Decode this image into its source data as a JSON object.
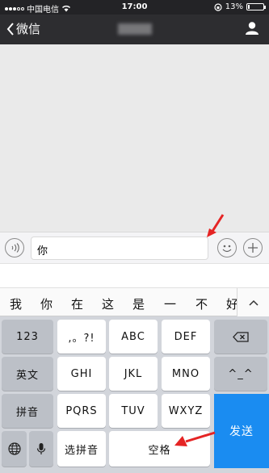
{
  "status_bar": {
    "carrier": "中国电信",
    "time": "17:00",
    "battery_percent": "13%",
    "battery_level": 0.13
  },
  "nav_bar": {
    "back_label": "微信"
  },
  "input_bar": {
    "text": "你"
  },
  "candidates": [
    "我",
    "你",
    "在",
    "这",
    "是",
    "一",
    "不",
    "好"
  ],
  "keyboard": {
    "row1": [
      "123",
      ",。?!",
      "ABC",
      "DEF"
    ],
    "row2": [
      "英文",
      "GHI",
      "JKL",
      "MNO",
      "^_^"
    ],
    "row3": [
      "拼音",
      "PQRS",
      "TUV",
      "WXYZ"
    ],
    "row4": [
      "选拼音",
      "空格"
    ],
    "send": "发送"
  },
  "colors": {
    "accent_send": "#1a8cf1",
    "annotation_arrow": "#e52424"
  }
}
